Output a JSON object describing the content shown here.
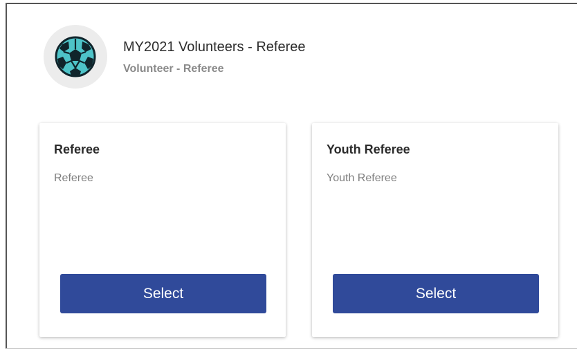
{
  "header": {
    "title": "MY2021 Volunteers - Referee",
    "subtitle": "Volunteer - Referee",
    "icon": "soccer-ball-icon"
  },
  "cards": [
    {
      "title": "Referee",
      "description": "Referee",
      "button_label": "Select"
    },
    {
      "title": "Youth Referee",
      "description": "Youth Referee",
      "button_label": "Select"
    }
  ],
  "colors": {
    "button": "#304a9a",
    "ball_panels": "#4ec3c8",
    "ball_patches": "#10242b"
  }
}
